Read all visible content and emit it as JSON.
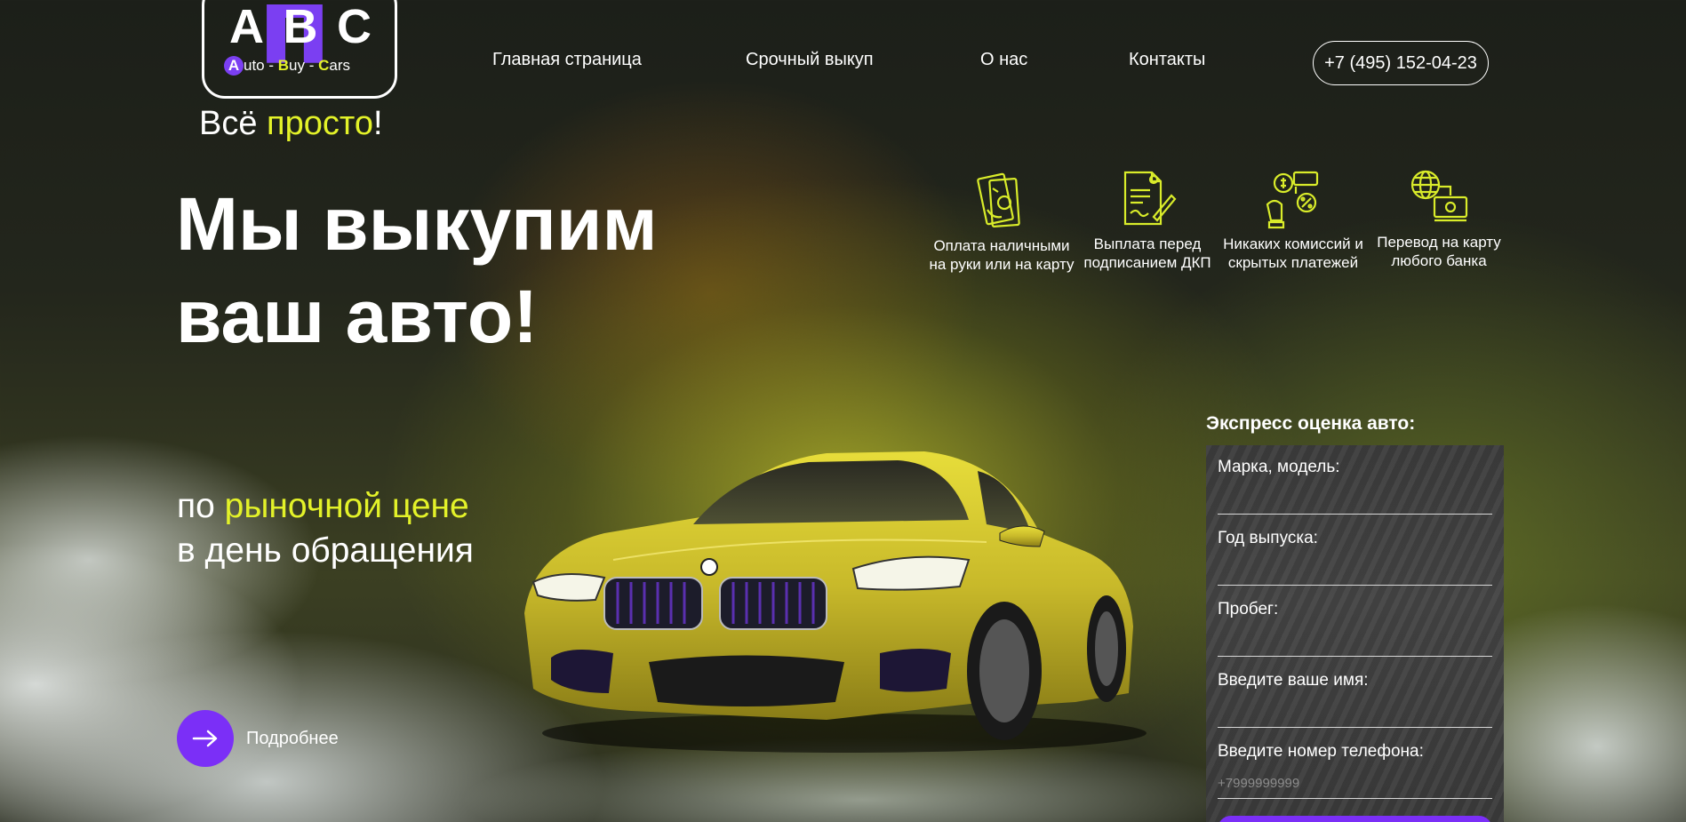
{
  "logo": {
    "letters": [
      "A",
      "B",
      "C"
    ],
    "overlay_letter": "п",
    "sub_initial_1": "A",
    "sub_rest_1": "uto",
    "sep": " - ",
    "sub_initial_2": "B",
    "sub_rest_2": "uy",
    "sub_initial_3": "C",
    "sub_rest_3": "ars"
  },
  "slogan": {
    "prefix": "Всё ",
    "accent": "просто",
    "suffix": "!"
  },
  "nav": {
    "items": [
      {
        "label": "Главная страница"
      },
      {
        "label": "Срочный выкуп"
      },
      {
        "label": "О нас"
      },
      {
        "label": "Контакты"
      }
    ],
    "phone": "+7 (495) 152-04-23"
  },
  "hero": {
    "title_line1": "Мы выкупим",
    "title_line2": "ваш авто!",
    "tagline_prefix": "по ",
    "tagline_accent": "рыночной цене",
    "tagline_line2": "в день обращения",
    "more_label": "Подробнее"
  },
  "features": [
    {
      "icon": "cash-icon",
      "text": "Оплата наличными на руки или на карту"
    },
    {
      "icon": "contract-icon",
      "text": "Выплата перед подписанием ДКП"
    },
    {
      "icon": "no-fees-icon",
      "text": "Никаких комиссий и скрытых платежей"
    },
    {
      "icon": "bank-transfer-icon",
      "text": "Перевод на карту любого банка"
    }
  ],
  "form": {
    "title": "Экспресс оценка авто:",
    "fields": [
      {
        "label": "Марка, модель:",
        "value": "",
        "placeholder": ""
      },
      {
        "label": "Год выпуска:",
        "value": "",
        "placeholder": ""
      },
      {
        "label": "Пробег:",
        "value": "",
        "placeholder": ""
      },
      {
        "label": "Введите ваше имя:",
        "value": "",
        "placeholder": ""
      },
      {
        "label": "Введите номер телефона:",
        "value": "",
        "placeholder": "+7999999999"
      }
    ]
  },
  "colors": {
    "accent_yellow": "#e3f229",
    "brand_purple": "#7b2ff7",
    "form_bg": "#404040"
  }
}
